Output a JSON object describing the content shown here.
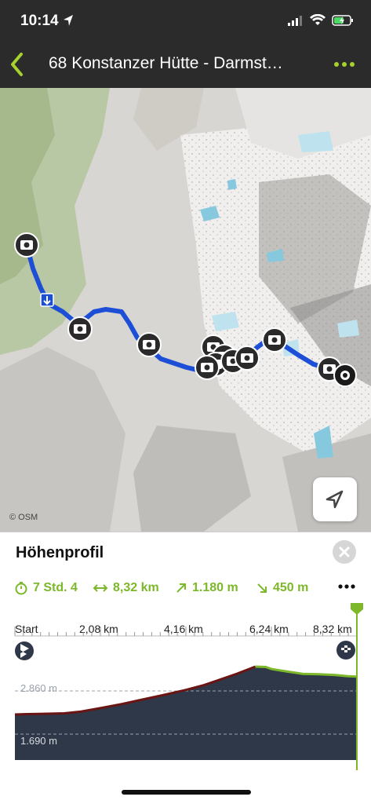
{
  "status": {
    "time": "10:14"
  },
  "nav": {
    "title": "68 Konstanzer Hütte - Darmst…",
    "accent": "#a7d12e"
  },
  "map": {
    "attribution": "© OSM",
    "route_color": "#1d4fd6"
  },
  "panel": {
    "title": "Höhenprofil",
    "stats": {
      "duration": "7 Std. 4",
      "distance": "8,32 km",
      "ascent": "1.180 m",
      "descent": "450 m"
    },
    "axis": {
      "ticks": [
        "Start",
        "2,08 km",
        "4,16 km",
        "6,24 km",
        "8,32 km"
      ]
    },
    "elev": {
      "high": "2.860 m",
      "low": "1.690 m"
    }
  },
  "chart_data": {
    "type": "area",
    "x": [
      0,
      0.3,
      0.6,
      0.9,
      1.2,
      1.6,
      2.08,
      2.6,
      3.1,
      3.6,
      4.16,
      4.6,
      5.0,
      5.4,
      5.85,
      6.1,
      6.24,
      6.6,
      7.0,
      7.4,
      7.8,
      8.1,
      8.32
    ],
    "values": [
      1690,
      1700,
      1705,
      1712,
      1720,
      1760,
      1850,
      1950,
      2060,
      2170,
      2300,
      2420,
      2560,
      2700,
      2880,
      2870,
      2820,
      2760,
      2700,
      2690,
      2670,
      2640,
      2630
    ],
    "xlabel": "",
    "ylabel": "",
    "xlim": [
      0,
      8.32
    ],
    "ylim": [
      1690,
      2860
    ]
  }
}
